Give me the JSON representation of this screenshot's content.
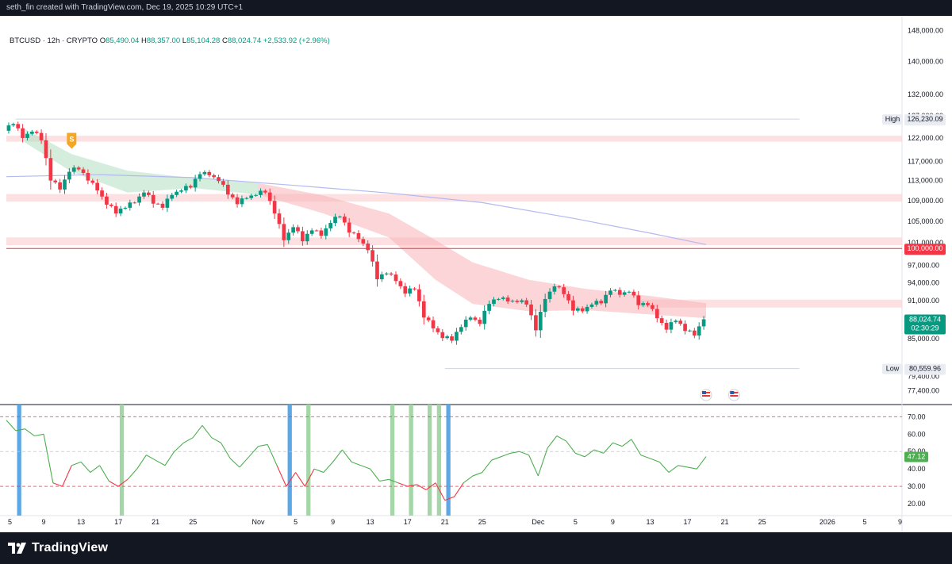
{
  "header": {
    "attribution": "seth_fin created with TradingView.com, Dec 19, 2025 10:29 UTC+1"
  },
  "legend": {
    "symbol": "BTCUSD · 12h · CRYPTO",
    "open_label": "O",
    "open": "85,490.04",
    "high_label": "H",
    "high": "88,357.00",
    "low_label": "L",
    "low": "85,104.28",
    "close_label": "C",
    "close": "88,024.74",
    "change": "+2,533.92 (+2.96%)"
  },
  "footer": {
    "brand": "TradingView"
  },
  "colors": {
    "up": "#089981",
    "down": "#f23645",
    "bearish_cloud": "#f7b2b6",
    "bullish_cloud": "#b2dfc0",
    "ma_line": "#b4b9f0",
    "rsi_line": "#4caf50",
    "rsi_low": "#f23645",
    "resistance_zone": "#fbd5d8",
    "level_line": "#f23645",
    "oversold_bar": "#5ca8e6",
    "bullish_bar": "#a5d6a7"
  },
  "chart_data": [
    {
      "type": "candlestick",
      "title": "BTCUSD · 12h · CRYPTO",
      "y_ticks": [
        "148,000.00",
        "140,000.00",
        "132,000.00",
        "127,000.00",
        "122,000.00",
        "117,000.00",
        "113,000.00",
        "109,000.00",
        "105,000.00",
        "101,000.00",
        "97,000.00",
        "94,000.00",
        "91,000.00",
        "85,000.00",
        "79,400.00",
        "77,400.00"
      ],
      "x_ticks": [
        "5",
        "9",
        "13",
        "17",
        "21",
        "25",
        "Nov",
        "5",
        "9",
        "13",
        "17",
        "21",
        "25",
        "Dec",
        "5",
        "9",
        "13",
        "17",
        "21",
        "25",
        "2026",
        "5",
        "9"
      ],
      "y_scale": "log",
      "ylim": [
        75500,
        152000
      ],
      "x_range_days": [
        "2025-10-05",
        "2026-01-09"
      ],
      "grid": false,
      "trend": [
        [
          "2025-10-05",
          123600
        ],
        [
          "2025-10-06",
          125100
        ],
        [
          "2025-10-07",
          122000
        ],
        [
          "2025-10-08",
          123400
        ],
        [
          "2025-10-09",
          121500
        ],
        [
          "2025-10-10",
          113000
        ],
        [
          "2025-10-11",
          111200
        ],
        [
          "2025-10-12",
          114800
        ],
        [
          "2025-10-13",
          115300
        ],
        [
          "2025-10-14",
          113000
        ],
        [
          "2025-10-15",
          111000
        ],
        [
          "2025-10-16",
          108200
        ],
        [
          "2025-10-17",
          106500
        ],
        [
          "2025-10-18",
          107600
        ],
        [
          "2025-10-19",
          108600
        ],
        [
          "2025-10-20",
          110600
        ],
        [
          "2025-10-21",
          108400
        ],
        [
          "2025-10-22",
          107600
        ],
        [
          "2025-10-23",
          110100
        ],
        [
          "2025-10-24",
          111000
        ],
        [
          "2025-10-25",
          111600
        ],
        [
          "2025-10-26",
          114300
        ],
        [
          "2025-10-27",
          114100
        ],
        [
          "2025-10-28",
          112900
        ],
        [
          "2025-10-29",
          110200
        ],
        [
          "2025-10-30",
          108300
        ],
        [
          "2025-10-31",
          109500
        ],
        [
          "2025-11-01",
          110100
        ],
        [
          "2025-11-02",
          110600
        ],
        [
          "2025-11-03",
          106500
        ],
        [
          "2025-11-04",
          101500
        ],
        [
          "2025-11-05",
          103900
        ],
        [
          "2025-11-06",
          101300
        ],
        [
          "2025-11-07",
          103300
        ],
        [
          "2025-11-08",
          102300
        ],
        [
          "2025-11-09",
          104700
        ],
        [
          "2025-11-10",
          105900
        ],
        [
          "2025-11-11",
          102900
        ],
        [
          "2025-11-12",
          101700
        ],
        [
          "2025-11-13",
          99700
        ],
        [
          "2025-11-14",
          94600
        ],
        [
          "2025-11-15",
          95600
        ],
        [
          "2025-11-16",
          94300
        ],
        [
          "2025-11-17",
          92200
        ],
        [
          "2025-11-18",
          92900
        ],
        [
          "2025-11-19",
          88300
        ],
        [
          "2025-11-20",
          86600
        ],
        [
          "2025-11-21",
          85100
        ],
        [
          "2025-11-22",
          84700
        ],
        [
          "2025-11-23",
          86800
        ],
        [
          "2025-11-24",
          88300
        ],
        [
          "2025-11-25",
          87300
        ],
        [
          "2025-11-26",
          90500
        ],
        [
          "2025-11-27",
          91300
        ],
        [
          "2025-11-28",
          90900
        ],
        [
          "2025-11-29",
          90800
        ],
        [
          "2025-11-30",
          90400
        ],
        [
          "2025-12-01",
          86300
        ],
        [
          "2025-12-02",
          91300
        ],
        [
          "2025-12-03",
          93400
        ],
        [
          "2025-12-04",
          92100
        ],
        [
          "2025-12-05",
          89400
        ],
        [
          "2025-12-06",
          89300
        ],
        [
          "2025-12-07",
          90400
        ],
        [
          "2025-12-08",
          90600
        ],
        [
          "2025-12-09",
          92700
        ],
        [
          "2025-12-10",
          92000
        ],
        [
          "2025-12-11",
          92500
        ],
        [
          "2025-12-12",
          90300
        ],
        [
          "2025-12-13",
          90300
        ],
        [
          "2025-12-14",
          88200
        ],
        [
          "2025-12-15",
          86400
        ],
        [
          "2025-12-16",
          87800
        ],
        [
          "2025-12-17",
          86200
        ],
        [
          "2025-12-18",
          85500
        ],
        [
          "2025-12-19",
          88025
        ]
      ],
      "last_price": "88,024.74",
      "countdown": "02:30:29",
      "high": {
        "label": "High",
        "value": "126,230.09"
      },
      "low": {
        "label": "Low",
        "value": "80,559.96"
      },
      "level": "100,000.00",
      "resistance_zones": [
        [
          121200,
          122500
        ],
        [
          108800,
          110300
        ],
        [
          100600,
          102000
        ],
        [
          89900,
          91200
        ]
      ],
      "ma_line": [
        [
          "2025-10-05",
          113800
        ],
        [
          "2025-10-15",
          114200
        ],
        [
          "2025-10-25",
          113600
        ],
        [
          "2025-11-05",
          112000
        ],
        [
          "2025-11-15",
          110500
        ],
        [
          "2025-11-25",
          108600
        ],
        [
          "2025-12-05",
          105500
        ],
        [
          "2025-12-13",
          102800
        ],
        [
          "2025-12-19",
          100700
        ]
      ],
      "cloud_upper": [
        [
          "2025-10-07",
          124000
        ],
        [
          "2025-10-12",
          118500
        ],
        [
          "2025-10-18",
          115000
        ],
        [
          "2025-10-25",
          113500
        ],
        [
          "2025-11-01",
          112500
        ],
        [
          "2025-11-08",
          110000
        ],
        [
          "2025-11-15",
          106500
        ],
        [
          "2025-11-20",
          101500
        ],
        [
          "2025-11-24",
          97500
        ],
        [
          "2025-11-30",
          94500
        ],
        [
          "2025-12-06",
          93000
        ],
        [
          "2025-12-13",
          91800
        ],
        [
          "2025-12-19",
          90600
        ]
      ],
      "cloud_lower": [
        [
          "2025-10-07",
          121000
        ],
        [
          "2025-10-12",
          114800
        ],
        [
          "2025-10-18",
          110600
        ],
        [
          "2025-10-25",
          111500
        ],
        [
          "2025-11-01",
          110200
        ],
        [
          "2025-11-08",
          106500
        ],
        [
          "2025-11-15",
          102000
        ],
        [
          "2025-11-20",
          94500
        ],
        [
          "2025-11-24",
          90500
        ],
        [
          "2025-11-30",
          89300
        ],
        [
          "2025-12-06",
          89500
        ],
        [
          "2025-12-13",
          88800
        ],
        [
          "2025-12-19",
          88200
        ]
      ],
      "signal_marker": {
        "label": "S",
        "date": "2025-10-12",
        "price": 120000
      },
      "event_flags": [
        "2025-12-19",
        "2025-12-22"
      ]
    },
    {
      "type": "line",
      "title": "",
      "y_ticks": [
        "70.00",
        "60.00",
        "50.00",
        "40.00",
        "30.00",
        "20.00"
      ],
      "ylim": [
        15,
        77
      ],
      "levels": [
        70,
        50,
        30
      ],
      "last_value": "47.12",
      "values": [
        [
          "2025-10-05",
          68
        ],
        [
          "2025-10-06",
          62
        ],
        [
          "2025-10-07",
          63
        ],
        [
          "2025-10-08",
          59
        ],
        [
          "2025-10-09",
          60
        ],
        [
          "2025-10-10",
          32
        ],
        [
          "2025-10-11",
          30
        ],
        [
          "2025-10-12",
          42
        ],
        [
          "2025-10-13",
          44
        ],
        [
          "2025-10-14",
          38
        ],
        [
          "2025-10-15",
          42
        ],
        [
          "2025-10-16",
          33
        ],
        [
          "2025-10-17",
          30
        ],
        [
          "2025-10-18",
          34
        ],
        [
          "2025-10-19",
          40
        ],
        [
          "2025-10-20",
          48
        ],
        [
          "2025-10-21",
          45
        ],
        [
          "2025-10-22",
          42
        ],
        [
          "2025-10-23",
          50
        ],
        [
          "2025-10-24",
          55
        ],
        [
          "2025-10-25",
          58
        ],
        [
          "2025-10-26",
          65
        ],
        [
          "2025-10-27",
          58
        ],
        [
          "2025-10-28",
          55
        ],
        [
          "2025-10-29",
          46
        ],
        [
          "2025-10-30",
          41
        ],
        [
          "2025-10-31",
          47
        ],
        [
          "2025-11-01",
          53
        ],
        [
          "2025-11-02",
          54
        ],
        [
          "2025-11-03",
          42
        ],
        [
          "2025-11-04",
          30
        ],
        [
          "2025-11-05",
          38
        ],
        [
          "2025-11-06",
          30
        ],
        [
          "2025-11-07",
          40
        ],
        [
          "2025-11-08",
          38
        ],
        [
          "2025-11-09",
          44
        ],
        [
          "2025-11-10",
          51
        ],
        [
          "2025-11-11",
          44
        ],
        [
          "2025-11-12",
          42
        ],
        [
          "2025-11-13",
          40
        ],
        [
          "2025-11-14",
          33
        ],
        [
          "2025-11-15",
          34
        ],
        [
          "2025-11-16",
          32
        ],
        [
          "2025-11-17",
          30
        ],
        [
          "2025-11-18",
          31
        ],
        [
          "2025-11-19",
          28
        ],
        [
          "2025-11-20",
          32
        ],
        [
          "2025-11-21",
          22
        ],
        [
          "2025-11-22",
          24
        ],
        [
          "2025-11-23",
          32
        ],
        [
          "2025-11-24",
          36
        ],
        [
          "2025-11-25",
          38
        ],
        [
          "2025-11-26",
          45
        ],
        [
          "2025-11-27",
          47
        ],
        [
          "2025-11-28",
          49
        ],
        [
          "2025-11-29",
          50
        ],
        [
          "2025-11-30",
          48
        ],
        [
          "2025-12-01",
          36
        ],
        [
          "2025-12-02",
          52
        ],
        [
          "2025-12-03",
          59
        ],
        [
          "2025-12-04",
          56
        ],
        [
          "2025-12-05",
          49
        ],
        [
          "2025-12-06",
          47
        ],
        [
          "2025-12-07",
          51
        ],
        [
          "2025-12-08",
          49
        ],
        [
          "2025-12-09",
          55
        ],
        [
          "2025-12-10",
          53
        ],
        [
          "2025-12-11",
          57
        ],
        [
          "2025-12-12",
          48
        ],
        [
          "2025-12-13",
          46
        ],
        [
          "2025-12-14",
          44
        ],
        [
          "2025-12-15",
          38
        ],
        [
          "2025-12-16",
          42
        ],
        [
          "2025-12-17",
          41
        ],
        [
          "2025-12-18",
          40
        ],
        [
          "2025-12-19",
          47.12
        ]
      ],
      "highlight_days": {
        "oversold": [
          "2025-10-06",
          "2025-11-04",
          "2025-11-21"
        ],
        "bullish": [
          "2025-10-17",
          "2025-11-06",
          "2025-11-15",
          "2025-11-17",
          "2025-11-19",
          "2025-11-20"
        ]
      }
    }
  ]
}
